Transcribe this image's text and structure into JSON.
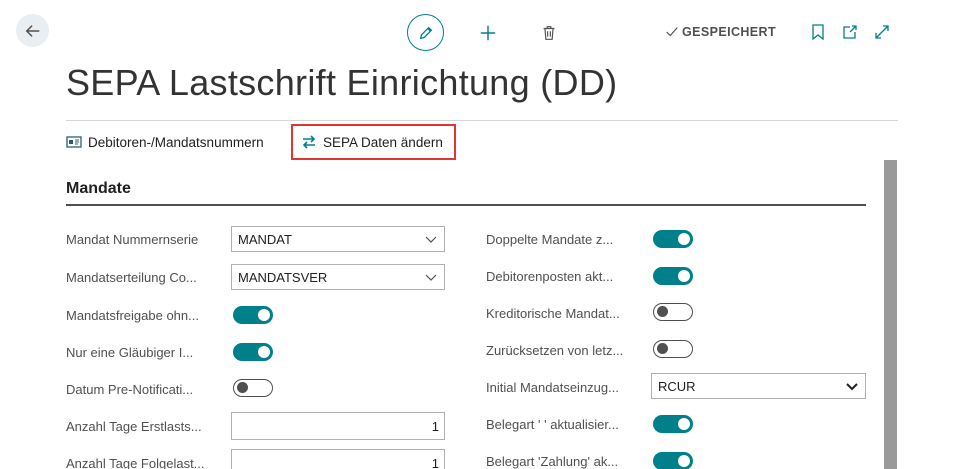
{
  "header": {
    "title": "SEPA Lastschrift Einrichtung (DD)",
    "saved_label": "GESPEICHERT"
  },
  "actions": [
    {
      "label": "Debitoren-/Mandatsnummern",
      "icon": "customer-numbers-icon"
    },
    {
      "label": "SEPA Daten ändern",
      "icon": "swap-arrows-icon",
      "highlighted": true
    }
  ],
  "section": {
    "title": "Mandate"
  },
  "left_fields": [
    {
      "label": "Mandat Nummernserie",
      "type": "select",
      "value": "MANDAT"
    },
    {
      "label": "Mandatserteilung Co...",
      "type": "select",
      "value": "MANDATSVER"
    },
    {
      "label": "Mandatsfreigabe ohn...",
      "type": "toggle",
      "value": true
    },
    {
      "label": "Nur eine Gläubiger I...",
      "type": "toggle",
      "value": true
    },
    {
      "label": "Datum Pre-Notificati...",
      "type": "toggle",
      "value": false
    },
    {
      "label": "Anzahl Tage Erstlasts...",
      "type": "number",
      "value": "1"
    },
    {
      "label": "Anzahl Tage Folgelast...",
      "type": "number",
      "value": "1"
    }
  ],
  "right_fields": [
    {
      "label": "Doppelte Mandate z...",
      "type": "toggle",
      "value": true
    },
    {
      "label": "Debitorenposten akt...",
      "type": "toggle",
      "value": true
    },
    {
      "label": "Kreditorische Mandat...",
      "type": "toggle",
      "value": false
    },
    {
      "label": "Zurücksetzen von letz...",
      "type": "toggle",
      "value": false
    },
    {
      "label": "Initial Mandatseinzug...",
      "type": "dropdown",
      "value": "RCUR"
    },
    {
      "label": "Belegart ' ' aktualisier...",
      "type": "toggle",
      "value": true
    },
    {
      "label": "Belegart 'Zahlung' ak...",
      "type": "toggle",
      "value": true
    }
  ],
  "colors": {
    "accent": "#00808a",
    "highlight_border": "#e03535"
  }
}
